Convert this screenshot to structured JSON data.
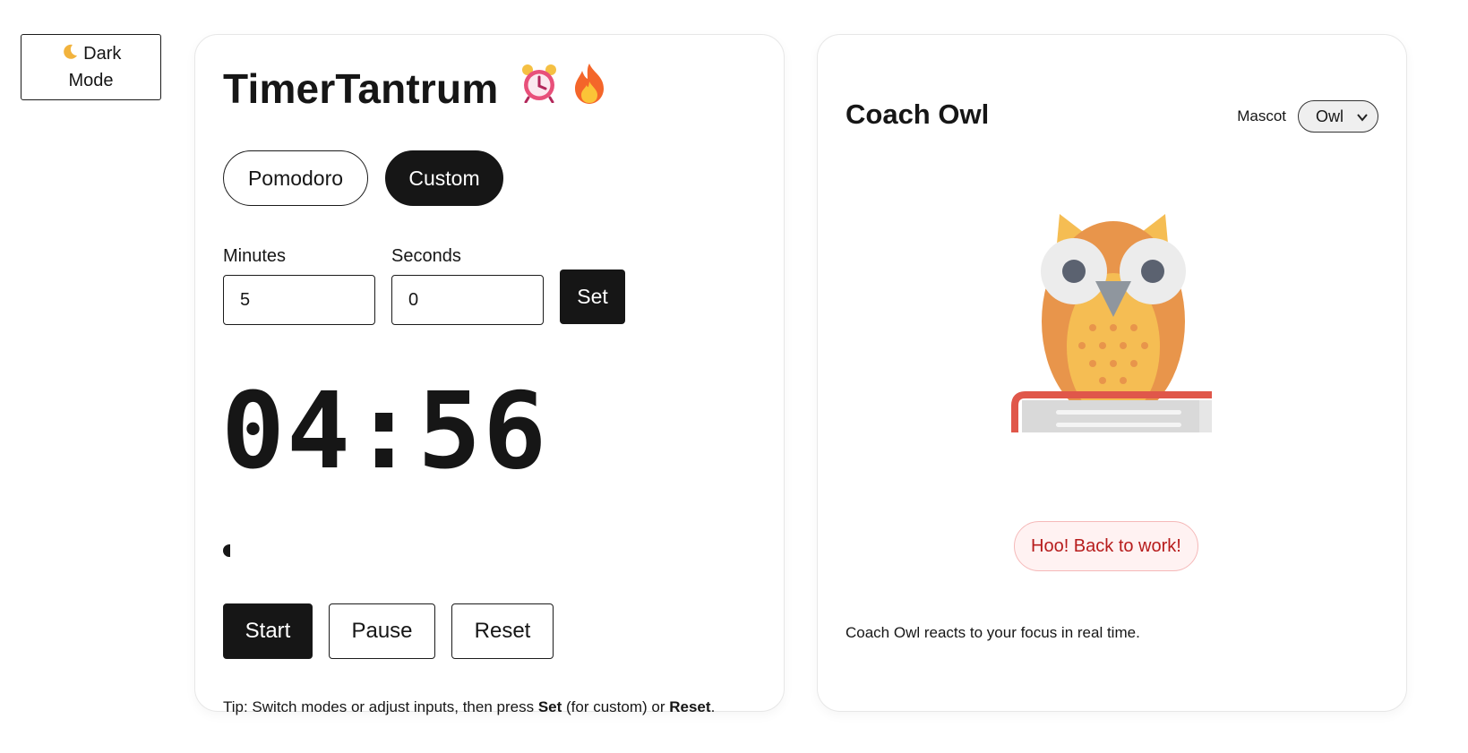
{
  "dark_mode": {
    "icon": "crescent-moon-icon",
    "label": "Dark Mode"
  },
  "timer": {
    "title": "TimerTantrum",
    "title_icons": [
      "alarm-clock-icon",
      "fire-icon"
    ],
    "modes": {
      "pomodoro": "Pomodoro",
      "custom": "Custom",
      "active": "Custom"
    },
    "minutes": {
      "label": "Minutes",
      "value": "5"
    },
    "seconds": {
      "label": "Seconds",
      "value": "0"
    },
    "set_label": "Set",
    "display": "04:56",
    "progress_percent": 1.3,
    "controls": {
      "start": "Start",
      "pause": "Pause",
      "reset": "Reset"
    },
    "tip": {
      "prefix": "Tip: Switch modes or adjust inputs, then press ",
      "set": "Set",
      "middle": " (for custom) or ",
      "reset": "Reset",
      "suffix": "."
    }
  },
  "coach": {
    "title": "Coach Owl",
    "mascot_label": "Mascot",
    "mascot_value": "Owl",
    "message": "Hoo! Back to work!",
    "caption": "Coach Owl reacts to your focus in real time."
  },
  "colors": {
    "primary": "#161616",
    "owl_body": "#e8954b",
    "owl_belly": "#f5bd53",
    "book": "#e0574a",
    "bubble_text": "#b71c1c",
    "bubble_bg": "#fff2f2"
  }
}
